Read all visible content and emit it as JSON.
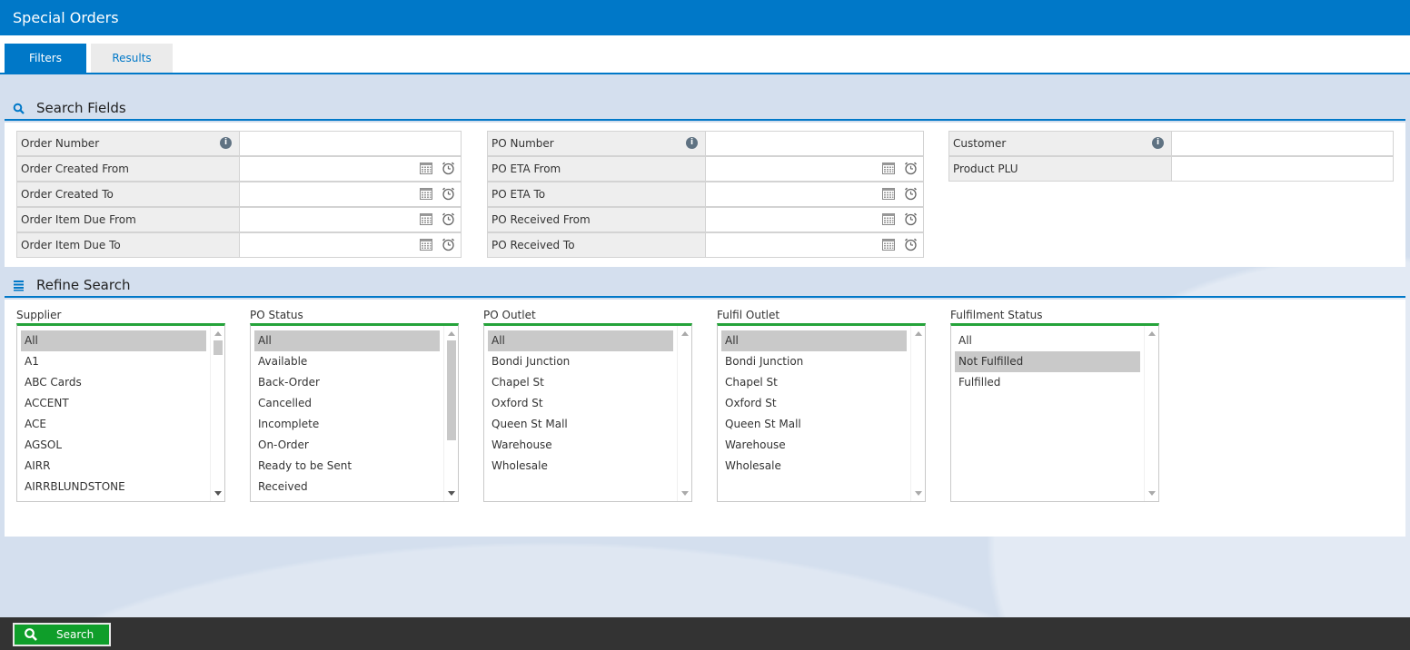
{
  "window": {
    "title": "Special Orders"
  },
  "tabs": [
    {
      "label": "Filters",
      "active": true
    },
    {
      "label": "Results",
      "active": false
    }
  ],
  "search_fields": {
    "header": "Search Fields",
    "columns": [
      [
        {
          "label": "Order Number",
          "info": true,
          "datetime": false,
          "value": ""
        },
        {
          "label": "Order Created From",
          "info": false,
          "datetime": true,
          "value": ""
        },
        {
          "label": "Order Created To",
          "info": false,
          "datetime": true,
          "value": ""
        },
        {
          "label": "Order Item Due From",
          "info": false,
          "datetime": true,
          "value": ""
        },
        {
          "label": "Order Item Due To",
          "info": false,
          "datetime": true,
          "value": ""
        }
      ],
      [
        {
          "label": "PO Number",
          "info": true,
          "datetime": false,
          "value": ""
        },
        {
          "label": "PO ETA From",
          "info": false,
          "datetime": true,
          "value": ""
        },
        {
          "label": "PO ETA To",
          "info": false,
          "datetime": true,
          "value": ""
        },
        {
          "label": "PO Received From",
          "info": false,
          "datetime": true,
          "value": ""
        },
        {
          "label": "PO Received To",
          "info": false,
          "datetime": true,
          "value": ""
        }
      ],
      [
        {
          "label": "Customer",
          "info": true,
          "datetime": false,
          "value": ""
        },
        {
          "label": "Product PLU",
          "info": false,
          "datetime": false,
          "value": ""
        }
      ]
    ]
  },
  "refine_search": {
    "header": "Refine Search",
    "groups": [
      {
        "title": "Supplier",
        "items": [
          "All",
          "A1",
          "ABC Cards",
          "ACCENT",
          "ACE",
          "AGSOL",
          "AIRR",
          "AIRRBLUNDSTONE"
        ],
        "selected": [
          0
        ],
        "scroll": true
      },
      {
        "title": "PO Status",
        "items": [
          "All",
          "Available",
          "Back-Order",
          "Cancelled",
          "Incomplete",
          "On-Order",
          "Ready to be Sent",
          "Received"
        ],
        "selected": [
          0
        ],
        "scroll": true
      },
      {
        "title": "PO Outlet",
        "items": [
          "All",
          "Bondi Junction",
          "Chapel St",
          "Oxford St",
          "Queen St Mall",
          "Warehouse",
          "Wholesale"
        ],
        "selected": [
          0
        ],
        "scroll": false
      },
      {
        "title": "Fulfil Outlet",
        "items": [
          "All",
          "Bondi Junction",
          "Chapel St",
          "Oxford St",
          "Queen St Mall",
          "Warehouse",
          "Wholesale"
        ],
        "selected": [
          0
        ],
        "scroll": false
      },
      {
        "title": "Fulfilment Status",
        "items": [
          "All",
          "Not Fulfilled",
          "Fulfilled"
        ],
        "selected": [
          1
        ],
        "scroll": false
      }
    ]
  },
  "footer": {
    "search_label": "Search"
  },
  "colors": {
    "accent": "#0078c8",
    "green": "#0f9e2a",
    "footer_bg": "#333333"
  }
}
